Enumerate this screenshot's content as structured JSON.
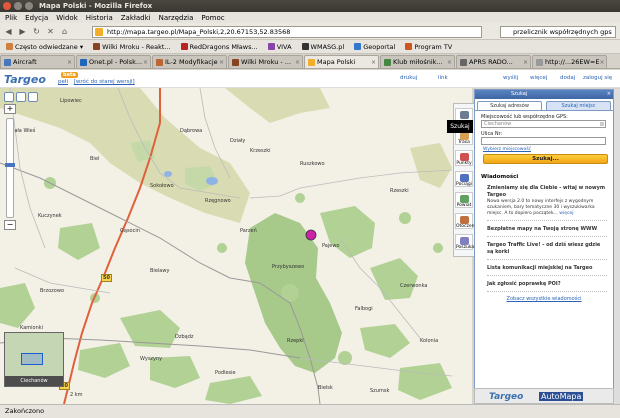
{
  "window": {
    "title": "Mapa Polski - Mozilla Firefox"
  },
  "menu": [
    "Plik",
    "Edycja",
    "Widok",
    "Historia",
    "Zakładki",
    "Narzędzia",
    "Pomoc"
  ],
  "nav": {
    "url": "http://mapa.targeo.pl/Mapa_Polski,2,20.67153,52.83568",
    "search_value": "przelicznik współrzędnych gps"
  },
  "bookmarks": [
    {
      "label": "Często odwiedzane ▾",
      "color": "#d08040"
    },
    {
      "label": "Wilki Mroku - Reakt...",
      "color": "#884422"
    },
    {
      "label": "RedDragons Mławs...",
      "color": "#bb2222"
    },
    {
      "label": "VIVA",
      "color": "#8844aa"
    },
    {
      "label": "WMASG.pl",
      "color": "#333333"
    },
    {
      "label": "Geoportal",
      "color": "#3377cc"
    },
    {
      "label": "Program TV",
      "color": "#cc5522"
    }
  ],
  "tabs": [
    {
      "label": "Aircraft",
      "color": "#4477bb",
      "active": false
    },
    {
      "label": "Onet.pl - Polsk...",
      "color": "#2266bb",
      "active": false
    },
    {
      "label": "IL-2 Modyfikacje",
      "color": "#bb6633",
      "active": false
    },
    {
      "label": "Wilki Mroku - ...",
      "color": "#884422",
      "active": false
    },
    {
      "label": "Mapa Polski",
      "color": "#f3ad2b",
      "active": true
    },
    {
      "label": "Klub miłośnik...",
      "color": "#448844",
      "active": false
    },
    {
      "label": "APRS RADO...",
      "color": "#666666",
      "active": false
    },
    {
      "label": "http://...26EW=E",
      "color": "#999999",
      "active": false
    }
  ],
  "site": {
    "logo": "Targeo",
    "logo_badge": "beta",
    "links": [
      "pełi",
      "[wróć do starej wersji]"
    ],
    "tools": [
      "drukuj",
      "link",
      "wyślij",
      "więcej",
      "dodaj",
      "zaloguj się"
    ]
  },
  "map": {
    "places": [
      "Lipowiec",
      "Dąbrowa",
      "Biel",
      "Sokołowo",
      "Kuczynek",
      "Ruszkowo",
      "Rzęgnowo",
      "Pajewo",
      "Bielawy",
      "Przybyszewo",
      "Brzozowo",
      "Kamionki",
      "Dzbądz",
      "Rzepki",
      "Wyszyny",
      "Bielsk",
      "Rzeszki",
      "Czerwonka",
      "Podlesie",
      "Szumsk",
      "Mała Wieś",
      "Gąsocin",
      "Parzeń",
      "Falbogi",
      "Kolonia",
      "Działy",
      "Krzeszki"
    ],
    "road_numbers": [
      "50",
      "50"
    ],
    "minimap_button": "Ciechanów",
    "scale": "2 km"
  },
  "right_tools": [
    "Szukaj",
    "Trasa",
    "Punkty",
    "Pociągi",
    "Powiat",
    "Otoczenie",
    "Poszukaj"
  ],
  "panel": {
    "header": "Szukaj",
    "close": "×",
    "tabs": [
      "Szukaj adresów",
      "Szukaj miejsc"
    ],
    "field1_label": "Miejscowość lub współrzędne GPS:",
    "field1_placeholder": "Ciechanów",
    "field2_label": "Ulica Nr:",
    "field2_placeholder": "",
    "obrys_link": "Wybierz miejscowość",
    "search_button": "Szukaj...",
    "news_title": "Wiadomości",
    "news": [
      {
        "title": "Zmieniamy się dla Ciebie - witaj w nowym Targeo",
        "body": "Nowa wersja 2.0 to nowy interfejs z wygodnym szukaniem, bary tematyczne 30 i wyszukiwarka miejsc. A to dopiero początek...",
        "more": "więcej"
      },
      {
        "title": "Bezpłatne mapy na Twoją stronę WWW",
        "body": "",
        "more": ""
      },
      {
        "title": "Targeo Traffic Live! - od dziś wiesz gdzie są korki",
        "body": "",
        "more": ""
      },
      {
        "title": "Lista komunikacji miejskiej na Targeo",
        "body": "",
        "more": ""
      },
      {
        "title": "Jak zgłosić poprawkę POI?",
        "body": "",
        "more": ""
      }
    ],
    "all_news": "Zobacz wszystkie wiadomości"
  },
  "ads": {
    "t1": "Targeo",
    "t2": "AutoMapa"
  },
  "status": "Zakończono"
}
